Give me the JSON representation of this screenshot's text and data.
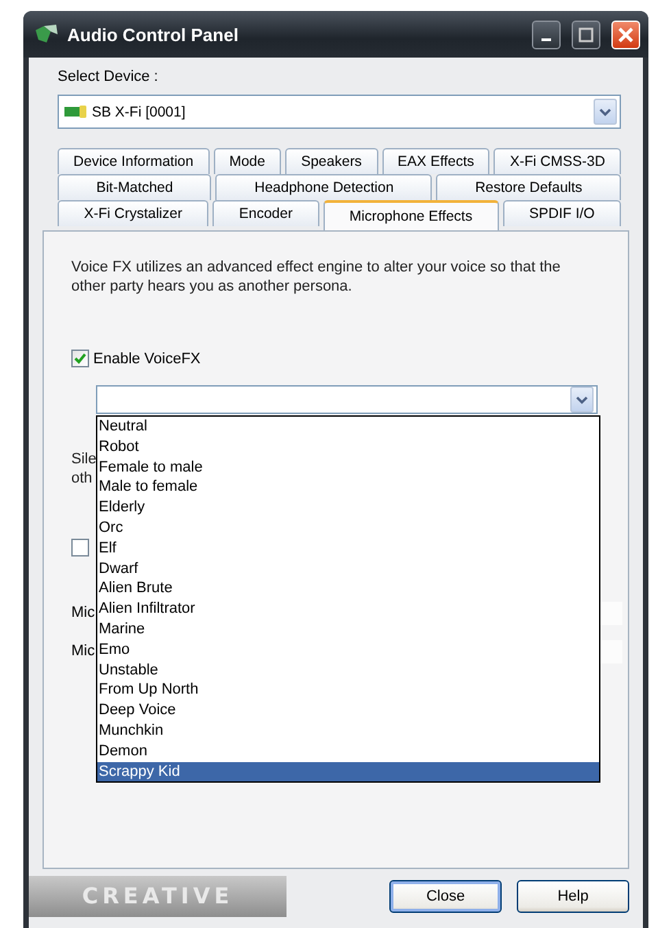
{
  "window": {
    "title": "Audio Control Panel"
  },
  "device": {
    "label": "Select Device :",
    "value": "SB X-Fi [0001]"
  },
  "tab_rows": [
    [
      {
        "label": "Device Information",
        "selected": false
      },
      {
        "label": "Mode",
        "selected": false
      },
      {
        "label": "Speakers",
        "selected": false
      },
      {
        "label": "EAX Effects",
        "selected": false
      },
      {
        "label": "X-Fi CMSS-3D",
        "selected": false
      }
    ],
    [
      {
        "label": "Bit-Matched",
        "selected": false
      },
      {
        "label": "Headphone Detection",
        "selected": false
      },
      {
        "label": "Restore Defaults",
        "selected": false
      }
    ],
    [
      {
        "label": "X-Fi Crystalizer",
        "selected": false
      },
      {
        "label": "Encoder",
        "selected": false
      },
      {
        "label": "Microphone Effects",
        "selected": true
      },
      {
        "label": "SPDIF I/O",
        "selected": false
      }
    ]
  ],
  "description": "Voice FX utilizes an advanced effect engine to alter your voice so that the other party hears you as another persona.",
  "enable": {
    "label": "Enable VoiceFX",
    "checked": true
  },
  "voice_dropdown": {
    "expanded": true,
    "options": [
      {
        "label": "Neutral",
        "selected": false
      },
      {
        "label": "Robot",
        "selected": false
      },
      {
        "label": "Female to male",
        "selected": false
      },
      {
        "label": "Male to female",
        "selected": false
      },
      {
        "label": "Elderly",
        "selected": false
      },
      {
        "label": "Orc",
        "selected": false
      },
      {
        "label": "Elf",
        "selected": false
      },
      {
        "label": "Dwarf",
        "selected": false
      },
      {
        "label": "Alien Brute",
        "selected": false
      },
      {
        "label": "Alien Infiltrator",
        "selected": false
      },
      {
        "label": "Marine",
        "selected": false
      },
      {
        "label": "Emo",
        "selected": false
      },
      {
        "label": "Unstable",
        "selected": false
      },
      {
        "label": "From Up North",
        "selected": false
      },
      {
        "label": "Deep Voice",
        "selected": false
      },
      {
        "label": "Munchkin",
        "selected": false
      },
      {
        "label": "Demon",
        "selected": false
      },
      {
        "label": "Scrappy Kid",
        "selected": true
      }
    ]
  },
  "covered": {
    "label_lines": [
      "Sile",
      "oth"
    ],
    "checkbox": {
      "checked": false
    },
    "rows": [
      {
        "label": "Mic"
      },
      {
        "label": "Mic"
      }
    ]
  },
  "logo": "CREATIVE",
  "buttons": [
    {
      "label": "Close",
      "default": true
    },
    {
      "label": "Help",
      "default": false
    }
  ]
}
